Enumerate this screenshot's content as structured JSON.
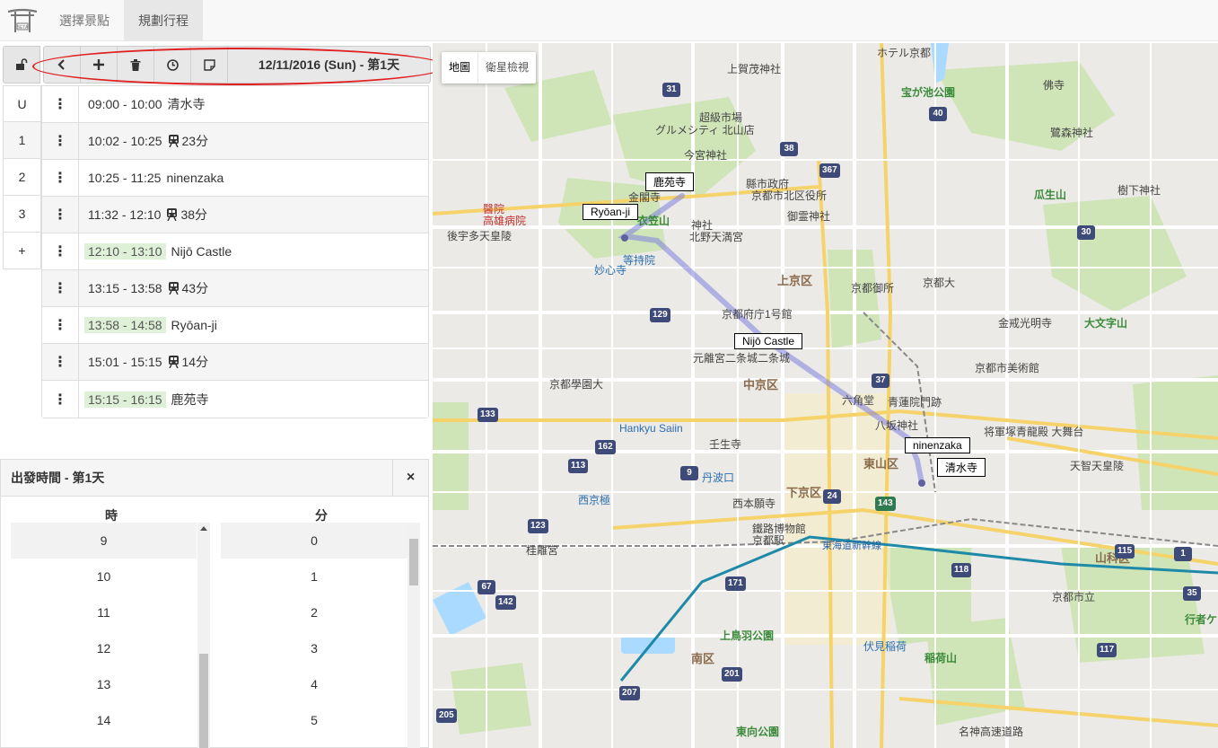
{
  "nav": {
    "tabs": [
      {
        "label": "選擇景點"
      },
      {
        "label": "規劃行程"
      }
    ]
  },
  "toolbar": {
    "date_label": "12/11/2016 (Sun) - 第1天",
    "icons": [
      "unlock-icon",
      "chevron-left-icon",
      "plus-icon",
      "trash-icon",
      "clock-icon",
      "note-icon"
    ]
  },
  "day_tabs": [
    "U",
    "1",
    "2",
    "3",
    "+"
  ],
  "schedule": [
    {
      "time": "09:00 - 10:00",
      "label": "清水寺",
      "type": "place",
      "highlight": false
    },
    {
      "time": "10:02 - 10:25",
      "label": "23分",
      "type": "transit",
      "highlight": false
    },
    {
      "time": "10:25 - 11:25",
      "label": "ninenzaka",
      "type": "place",
      "highlight": false
    },
    {
      "time": "11:32 - 12:10",
      "label": "38分",
      "type": "transit",
      "highlight": false
    },
    {
      "time": "12:10 - 13:10",
      "label": "Nijō Castle",
      "type": "place",
      "highlight": true
    },
    {
      "time": "13:15 - 13:58",
      "label": "43分",
      "type": "transit",
      "highlight": false
    },
    {
      "time": "13:58 - 14:58",
      "label": "Ryōan-ji",
      "type": "place",
      "highlight": true
    },
    {
      "time": "15:01 - 15:15",
      "label": "14分",
      "type": "transit",
      "highlight": false
    },
    {
      "time": "15:15 - 16:15",
      "label": "鹿苑寺",
      "type": "place",
      "highlight": true
    }
  ],
  "departure": {
    "title": "出發時間 - 第1天",
    "close_label": "×",
    "hour_header": "時",
    "minute_header": "分",
    "hours": [
      "9",
      "10",
      "11",
      "12",
      "13",
      "14"
    ],
    "minutes": [
      "0",
      "1",
      "2",
      "3",
      "4",
      "5"
    ],
    "selected_hour": "9",
    "selected_minute": "0"
  },
  "map": {
    "type_buttons": [
      "地圖",
      "衛星檢視"
    ],
    "markers": [
      {
        "label": "鹿苑寺"
      },
      {
        "label": "Ryōan-ji"
      },
      {
        "label": "Nijō Castle"
      },
      {
        "label": "ninenzaka"
      },
      {
        "label": "清水寺"
      }
    ],
    "labels": [
      "ホテル京都",
      "上賀茂神社",
      "宝が池公園",
      "佛寺",
      "超級市場",
      "グルメシティ 北山店",
      "今宮神社",
      "縣市政府",
      "京都市北区役所",
      "金閣寺",
      "衣笠山",
      "神社",
      "北野天満宮",
      "御霊神社",
      "後宇多天皇陵",
      "醫院",
      "高雄病院",
      "等持院",
      "妙心寺",
      "上京区",
      "京都御所",
      "京都府庁1号館",
      "二条城",
      "元離宮二条城",
      "中京区",
      "京都學園大",
      "六角堂",
      "青蓮院門跡",
      "八坂神社",
      "京都市美術館",
      "将軍塚青龍殿 大舞台",
      "天智天皇陵",
      "下京区",
      "西本願寺",
      "鐵路博物館",
      "京都駅",
      "東海道新幹線",
      "南区",
      "東山区",
      "山科区",
      "京都市立",
      "鷺森神社",
      "瓜生山",
      "樹下神社",
      "金戒光明寺",
      "大文字山",
      "京都大",
      "Hankyu Saiin",
      "壬生寺",
      "丹波口",
      "西京極",
      "桂離宮",
      "上鳥羽公園",
      "伏見稲荷",
      "稲荷山",
      "東向公園",
      "名神高速道路",
      "行者ケ"
    ],
    "road_shields": [
      "31",
      "38",
      "367",
      "40",
      "30",
      "37",
      "129",
      "133",
      "162",
      "113",
      "9",
      "24",
      "143",
      "123",
      "67",
      "142",
      "171",
      "201",
      "207",
      "205",
      "115",
      "118",
      "35",
      "117",
      "1"
    ]
  },
  "colors": {
    "highlight_bg": "#dff0d8",
    "route": "#8080e0",
    "annotation_oval": "#e02020"
  }
}
